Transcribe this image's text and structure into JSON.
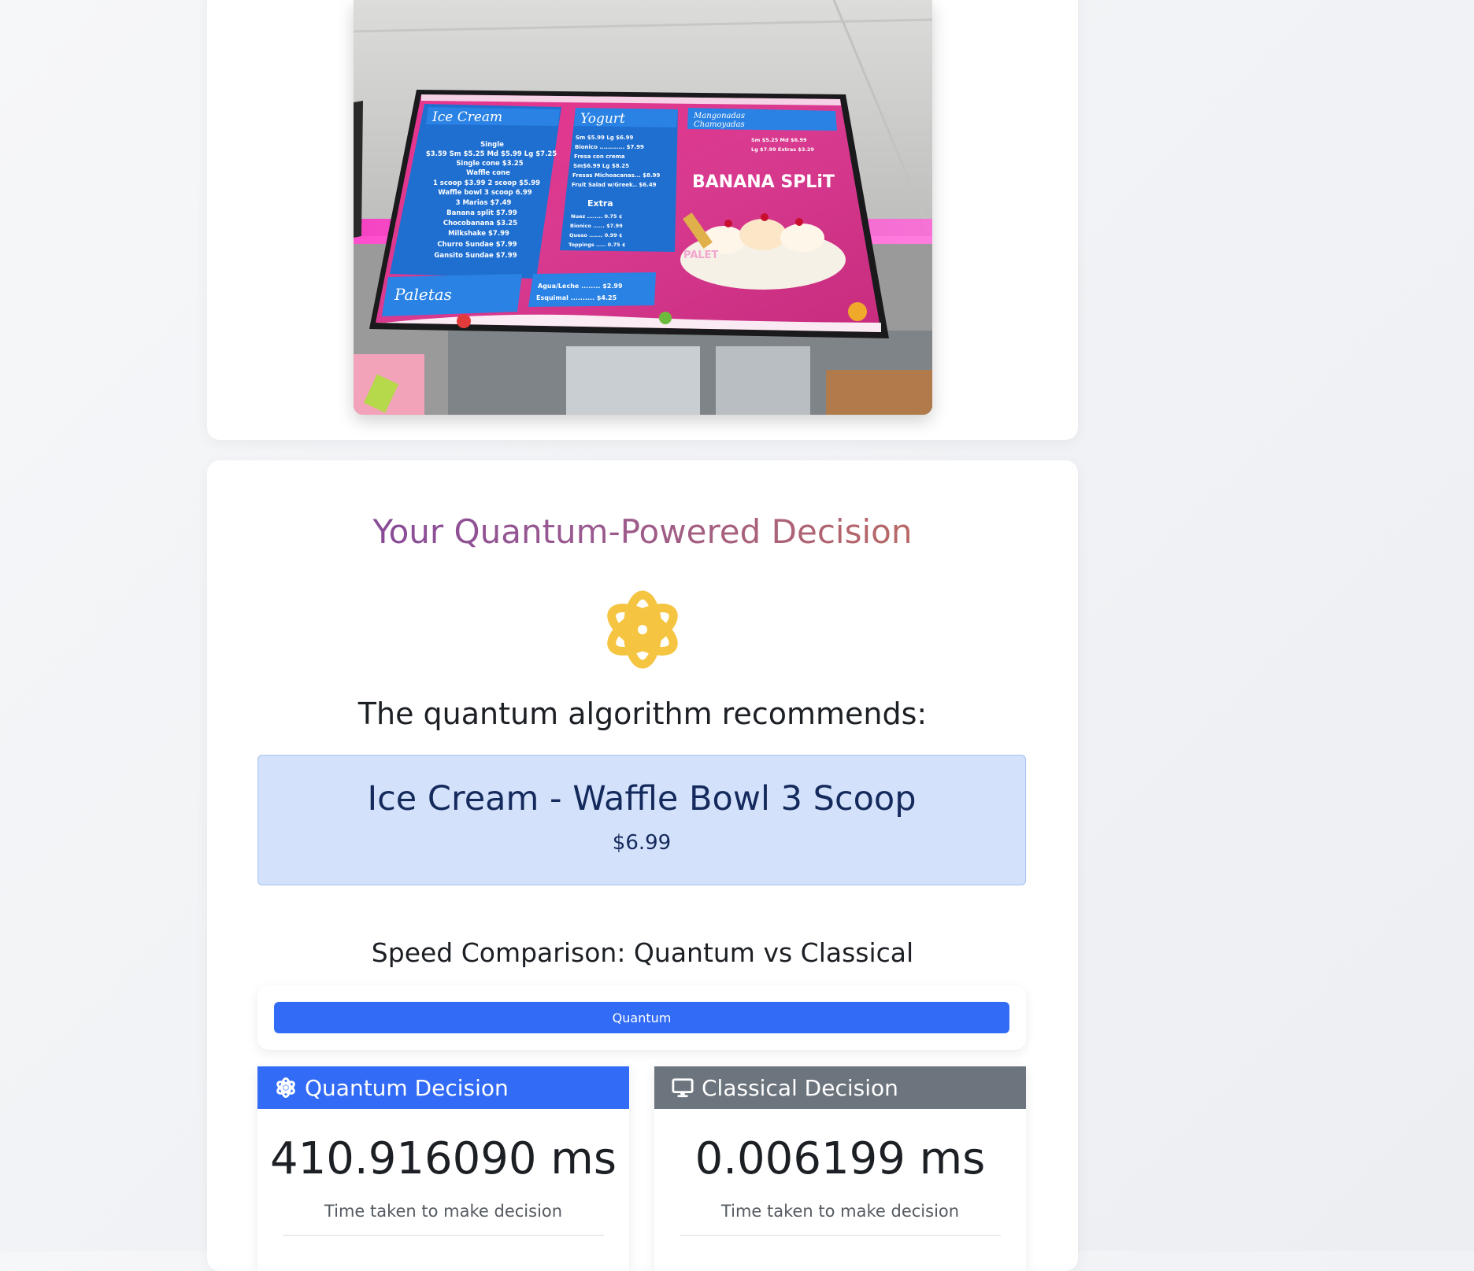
{
  "photo": {
    "alt_subject": "ice cream shop menu board",
    "menu": {
      "ice_cream_title": "Ice Cream",
      "ice_cream_lines": [
        "Single",
        "$3.59 Sm $5.25 Md $5.99 Lg $7.25",
        "Single cone $3.25",
        "Waffle cone",
        "1 scoop $3.99 2 scoop $5.99",
        "Waffle bowl 3 scoop 6.99",
        "3 Marias $7.49",
        "Banana split $7.99",
        "Chocobanana $3.25",
        "Milkshake $7.99",
        "Churro Sundae $7.99",
        "Gansito Sundae $7.99"
      ],
      "yogurt_title": "Yogurt",
      "yogurt_lines": [
        "Sm $5.99   Lg $6.99",
        "Bionico ............ $7.99",
        "Fresa con crema",
        "Sm$6.99   Lg $8.25",
        "Fresas Michoacanas... $8.99",
        "Fruit Salad w/Greek.. $6.49"
      ],
      "extra_title": "Extra",
      "extra_lines": [
        "Nuez ........ 0.75 ¢",
        "Bionico ...... $7.99",
        "Queso ....... 0.99 ¢",
        "Toppings ..... 0.75 ¢"
      ],
      "mango_title_1": "Mangonadas",
      "mango_title_2": "Chamoyadas",
      "mango_lines": [
        "Sm $5.25   Md $6.99",
        "Lg $7.99   Extras $3.29"
      ],
      "banana_split": "BANANA SPLiT",
      "paletas_title": "Paletas",
      "paleta_tag": "PALET",
      "drinks_lines": [
        "Agua/Leche ........ $2.99",
        "Esquimal .......... $4.25"
      ]
    }
  },
  "result": {
    "title": "Your Quantum-Powered Decision",
    "recommends": "The quantum algorithm recommends:",
    "item_name": "Ice Cream - Waffle Bowl 3 Scoop",
    "item_price": "$6.99",
    "speed_title": "Speed Comparison: Quantum vs Classical",
    "bar_label": "Quantum",
    "bar_fill_percent": 100
  },
  "quantum_card": {
    "title": "Quantum Decision",
    "time": "410.916090 ms",
    "caption": "Time taken to make decision"
  },
  "classical_card": {
    "title": "Classical Decision",
    "time": "0.006199 ms",
    "caption": "Time taken to make decision"
  },
  "colors": {
    "accent_blue": "#326bf5",
    "classical_gray": "#6c757d",
    "atom_yellow": "#f5c542",
    "rec_box_bg": "#d3e1fb",
    "rec_text": "#152a5c"
  },
  "icons": {
    "hero": "atom-icon",
    "quantum": "atom-icon",
    "classical": "desktop-icon"
  }
}
